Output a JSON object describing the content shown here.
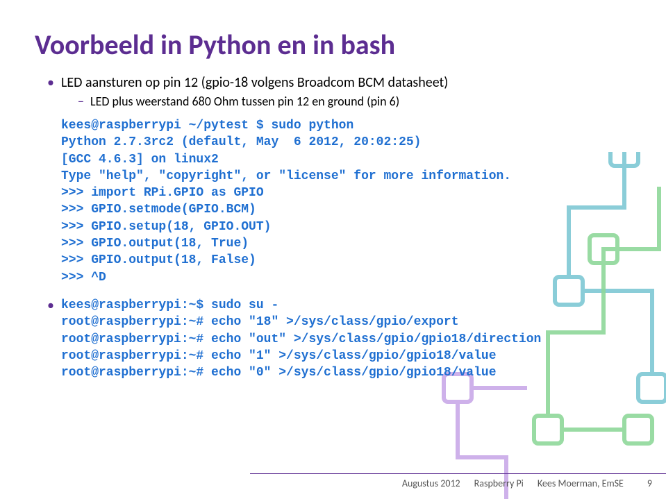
{
  "title": "Voorbeeld in Python en in bash",
  "bullet1": "LED aansturen op pin 12 (gpio-18 volgens Broadcom BCM datasheet)",
  "bullet1sub": "LED plus weerstand 680 Ohm tussen pin 12 en ground (pin 6)",
  "code1": "kees@raspberrypi ~/pytest $ sudo python\nPython 2.7.3rc2 (default, May  6 2012, 20:02:25)\n[GCC 4.6.3] on linux2\nType \"help\", \"copyright\", or \"license\" for more information.\n>>> import RPi.GPIO as GPIO\n>>> GPIO.setmode(GPIO.BCM)\n>>> GPIO.setup(18, GPIO.OUT)\n>>> GPIO.output(18, True)\n>>> GPIO.output(18, False)\n>>> ^D",
  "code2": "kees@raspberrypi:~$ sudo su -\nroot@raspberrypi:~# echo \"18\" >/sys/class/gpio/export\nroot@raspberrypi:~# echo \"out\" >/sys/class/gpio/gpio18/direction\nroot@raspberrypi:~# echo \"1\" >/sys/class/gpio/gpio18/value\nroot@raspberrypi:~# echo \"0\" >/sys/class/gpio/gpio18/value",
  "footer": {
    "date": "Augustus 2012",
    "topic": "Raspberry Pi",
    "author": "Kees Moerman, EmSE",
    "slide": "9"
  }
}
